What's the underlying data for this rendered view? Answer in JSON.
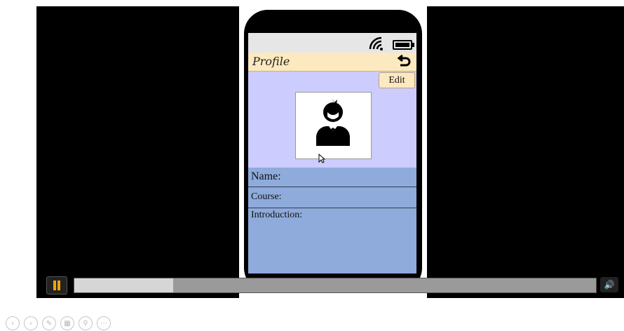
{
  "profile": {
    "title": "Profile",
    "edit_label": "Edit",
    "name_label": "Name:",
    "course_label": "Course:",
    "intro_label": "Introduction:"
  },
  "status_icons": [
    "wifi-icon",
    "battery-icon"
  ],
  "player": {
    "progress_fraction": 0.19,
    "state": "playing"
  },
  "toolbar_icons": [
    "prev-icon",
    "next-icon",
    "pen-icon",
    "grid-icon",
    "zoom-icon",
    "more-icon"
  ],
  "colors": {
    "title_bar": "#fde9c0",
    "screen_bg": "#ccccff",
    "info_bg": "#8fabdc",
    "pause_accent": "#f2a300"
  }
}
